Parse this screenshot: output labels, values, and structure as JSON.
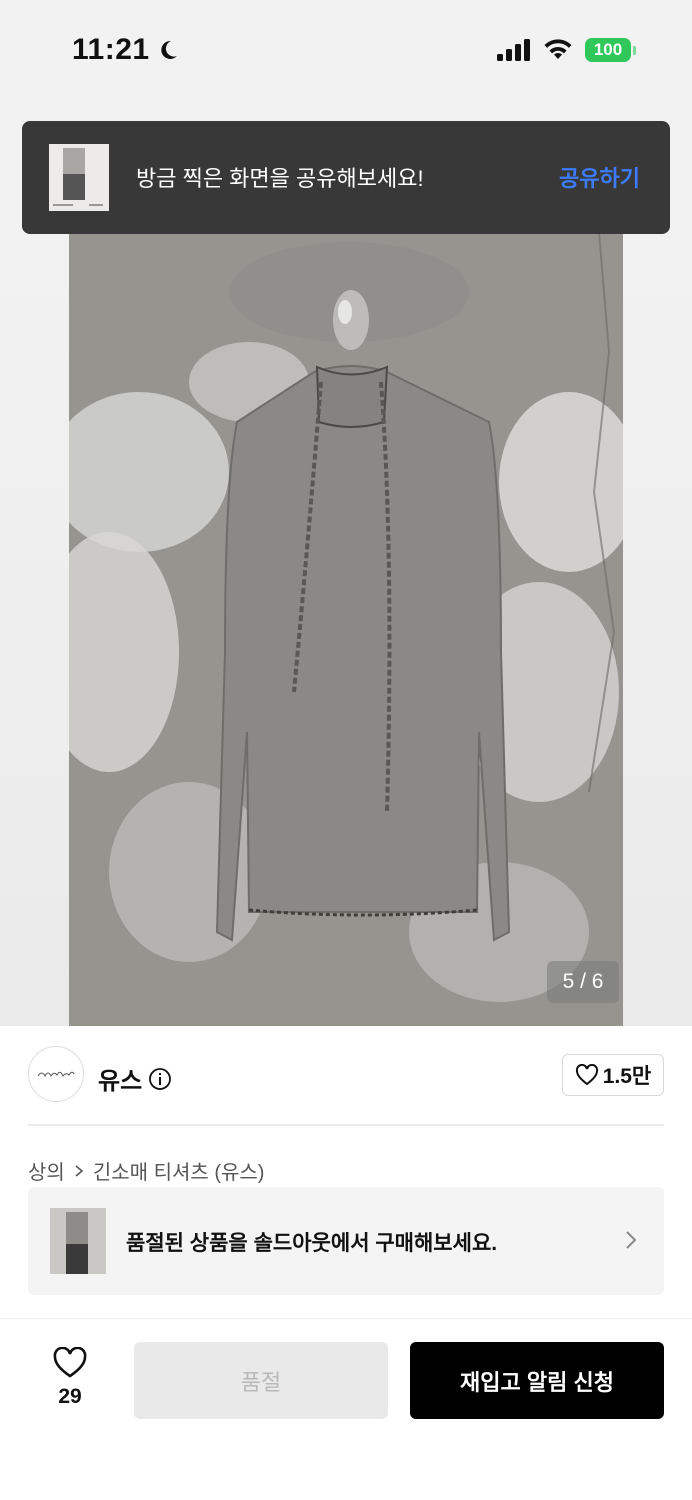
{
  "status_bar": {
    "time": "11:21",
    "battery": "100"
  },
  "toast": {
    "message": "방금 찍은 화면을 공유해보세요!",
    "action": "공유하기"
  },
  "gallery": {
    "counter": "5 / 6"
  },
  "brand": {
    "name": "유스",
    "likes": "1.5만"
  },
  "breadcrumb": {
    "category": "상의",
    "subcategory": "긴소매 티셔츠 (유스)"
  },
  "soldout_banner": {
    "text": "품절된 상품을 솔드아웃에서 구매해보세요."
  },
  "bottom_bar": {
    "wish_count": "29",
    "soldout_label": "품절",
    "restock_label": "재입고 알림 신청"
  },
  "colors": {
    "accent_blue": "#3d7bff",
    "battery_green": "#30c85a",
    "primary_button": "#000000"
  }
}
